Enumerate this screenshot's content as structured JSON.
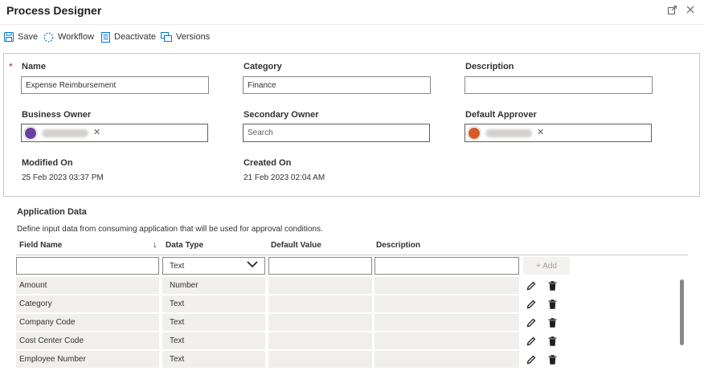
{
  "window": {
    "title": "Process Designer",
    "popout_icon": "popout-icon",
    "close_icon": "close-icon"
  },
  "toolbar": {
    "save_label": "Save",
    "workflow_label": "Workflow",
    "deactivate_label": "Deactivate",
    "versions_label": "Versions"
  },
  "form": {
    "required_marker": "*",
    "name": {
      "label": "Name",
      "value": "Expense Reimbursement"
    },
    "category": {
      "label": "Category",
      "value": "Finance"
    },
    "description": {
      "label": "Description",
      "value": ""
    },
    "business_owner": {
      "label": "Business Owner",
      "avatar_color": "#6b3fa0",
      "remove": "✕"
    },
    "secondary_owner": {
      "label": "Secondary Owner",
      "placeholder": "Search"
    },
    "default_approver": {
      "label": "Default Approver",
      "avatar_color": "#d65a2a",
      "remove": "✕"
    },
    "modified_on": {
      "label": "Modified On",
      "value": "25 Feb 2023 03:37 PM"
    },
    "created_on": {
      "label": "Created On",
      "value": "21 Feb 2023 02:04 AM"
    }
  },
  "app_data": {
    "title": "Application Data",
    "description": "Define input data from consuming application that will be used for approval conditions.",
    "columns": {
      "field_name": "Field Name",
      "data_type": "Data Type",
      "default_value": "Default Value",
      "description": "Description",
      "sort_arrow": "↓"
    },
    "new_row": {
      "data_type": "Text",
      "add_label": "+ Add"
    },
    "rows": [
      {
        "field_name": "Amount",
        "data_type": "Number"
      },
      {
        "field_name": "Category",
        "data_type": "Text"
      },
      {
        "field_name": "Company Code",
        "data_type": "Text"
      },
      {
        "field_name": "Cost Center Code",
        "data_type": "Text"
      },
      {
        "field_name": "Employee Number",
        "data_type": "Text"
      }
    ]
  },
  "colors": {
    "accent": "#0078d4",
    "required": "#a4262c"
  }
}
